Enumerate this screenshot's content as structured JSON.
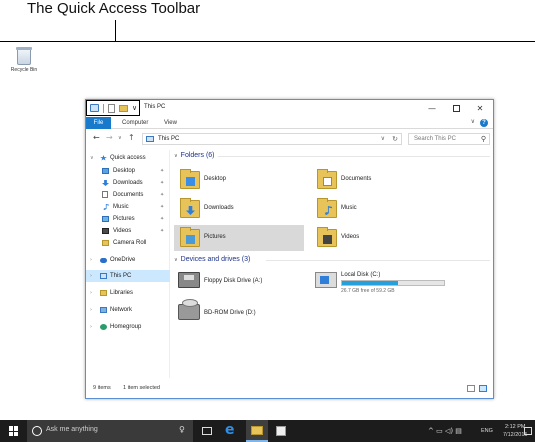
{
  "callout": {
    "text": "The Quick Access Toolbar"
  },
  "desktop": {
    "recycle_bin_label": "Recycle Bin"
  },
  "window": {
    "title": "This PC",
    "ribbon": {
      "tabs": [
        "File",
        "Computer",
        "View"
      ]
    },
    "address": {
      "crumb": "This PC",
      "search_placeholder": "Search This PC"
    },
    "nav": {
      "quick_access": "Quick access",
      "pinned": [
        "Desktop",
        "Downloads",
        "Documents",
        "Music",
        "Pictures",
        "Videos"
      ],
      "camera_roll": "Camera Roll",
      "onedrive": "OneDrive",
      "this_pc": "This PC",
      "libraries": "Libraries",
      "network": "Network",
      "homegroup": "Homegroup"
    },
    "folders": {
      "header": "Folders (6)",
      "items": [
        "Desktop",
        "Documents",
        "Downloads",
        "Music",
        "Pictures",
        "Videos"
      ]
    },
    "drives": {
      "header": "Devices and drives (3)",
      "floppy": "Floppy Disk Drive (A:)",
      "local": {
        "name": "Local Disk (C:)",
        "free": "26.7 GB free of 59.2 GB",
        "used_fraction": 0.55
      },
      "bd": "BD-ROM Drive (D:)"
    },
    "status": {
      "count": "9 items",
      "selected": "1 item selected"
    }
  },
  "taskbar": {
    "search_placeholder": "Ask me anything",
    "lang": "ENG",
    "time": "2:12 PM",
    "date": "7/12/2015"
  },
  "colors": {
    "accent": "#1979ca",
    "taskbar": "#1c1c1c",
    "selection": "#cce8ff",
    "drive_fill": "#26a0da"
  }
}
